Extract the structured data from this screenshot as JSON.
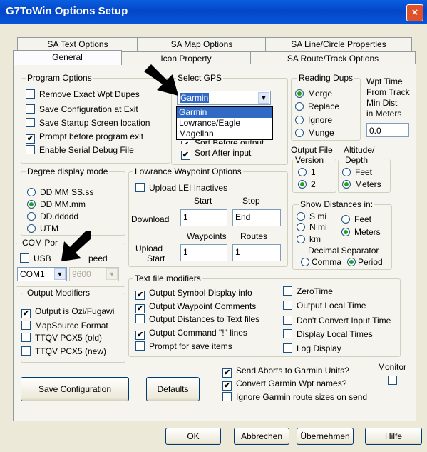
{
  "window": {
    "title": "G7ToWin Options Setup",
    "close": "×"
  },
  "tabs_back": [
    "SA Text Options",
    "SA Map Options",
    "SA Line/Circle Properties"
  ],
  "tabs_front": [
    "General",
    "Icon Property",
    "SA Route/Track Options"
  ],
  "program_options": {
    "label": "Program Options",
    "items": [
      {
        "label": "Remove Exact Wpt Dupes",
        "checked": false
      },
      {
        "label": "Save Configuration at Exit",
        "checked": false
      },
      {
        "label": "Save Startup Screen location",
        "checked": false
      },
      {
        "label": "Prompt before program exit",
        "checked": true
      },
      {
        "label": "Enable Serial Debug File",
        "checked": false
      }
    ]
  },
  "select_gps": {
    "label": "Select GPS",
    "value": "Garmin",
    "options": [
      "Garmin",
      "Lowrance/Eagle",
      "Magellan"
    ],
    "sort_before": "Sort Before output",
    "sort_after": "Sort After input"
  },
  "reading_dups": {
    "label": "Reading Dups",
    "options": [
      "Merge",
      "Replace",
      "Ignore",
      "Munge"
    ],
    "selected": 0
  },
  "wpt_time": {
    "label_lines": [
      "Wpt Time",
      "From Track",
      "Min Dist",
      "in Meters"
    ],
    "value": "0.0"
  },
  "output_file_version": {
    "label_lines": [
      "Output File",
      "Version"
    ],
    "options": [
      "1",
      "2"
    ],
    "selected": 1
  },
  "altitude_depth": {
    "label_lines": [
      "Altitude/",
      "Depth"
    ],
    "options": [
      "Feet",
      "Meters"
    ],
    "selected": 1
  },
  "degree_display": {
    "label": "Degree display mode",
    "options": [
      "DD MM SS.ss",
      "DD MM.mm",
      "DD.ddddd",
      "UTM"
    ],
    "selected": 1
  },
  "lowrance": {
    "label": "Lowrance Waypoint Options",
    "upload_lei": "Upload LEI Inactives",
    "start_label": "Start",
    "stop_label": "Stop",
    "download_label": "Download",
    "download_start": "1",
    "download_stop": "End",
    "waypoints_label": "Waypoints",
    "routes_label": "Routes",
    "upload_start_lines": [
      "Upload",
      "Start"
    ],
    "waypoints_value": "1",
    "routes_value": "1"
  },
  "show_distances": {
    "label": "Show Distances in:",
    "left": [
      "S mi",
      "N mi",
      "km"
    ],
    "right": [
      "Feet",
      "Meters"
    ],
    "selected": "Meters",
    "decimal_label": "Decimal Separator",
    "decimal_options": [
      "Comma",
      "Period"
    ],
    "decimal_selected": 1
  },
  "com_port": {
    "label": "COM Por",
    "usb": "USB",
    "speed": "peed",
    "port": "COM1",
    "baud": "9600"
  },
  "output_modifiers": {
    "label": "Output Modifiers",
    "items": [
      {
        "label": "Output is Ozi/Fugawi",
        "checked": true
      },
      {
        "label": "MapSource Format",
        "checked": false
      },
      {
        "label": "TTQV PCX5 (old)",
        "checked": false
      },
      {
        "label": "TTQV PCX5 (new)",
        "checked": false
      }
    ]
  },
  "text_file_modifiers": {
    "label": "Text file modifiers",
    "left": [
      {
        "label": "Output Symbol Display info",
        "checked": true
      },
      {
        "label": "Output Waypoint Comments",
        "checked": true
      },
      {
        "label": "Output Distances to Text files",
        "checked": false
      },
      {
        "label": "Output Command \"!\" lines",
        "checked": true
      },
      {
        "label": "Prompt for save items",
        "checked": false
      }
    ],
    "right": [
      {
        "label": "ZeroTime",
        "checked": false
      },
      {
        "label": "Output Local Time",
        "checked": false
      },
      {
        "label": "Don't Convert Input Time",
        "checked": false
      },
      {
        "label": "Display Local Times",
        "checked": false
      },
      {
        "label": "Log Display",
        "checked": false
      }
    ]
  },
  "garmin_options": [
    {
      "label": "Send Aborts to Garmin Units?",
      "checked": true
    },
    {
      "label": "Convert Garmin Wpt names?",
      "checked": true
    },
    {
      "label": "Ignore Garmin route sizes on send",
      "checked": false
    }
  ],
  "monitor": {
    "label": "Monitor",
    "checked": false
  },
  "buttons": {
    "save_config": "Save Configuration",
    "defaults": "Defaults",
    "ok": "OK",
    "cancel": "Abbrechen",
    "apply": "Übernehmen",
    "help": "Hilfe"
  },
  "checkmark": "✔",
  "combo_arrow": "▼"
}
